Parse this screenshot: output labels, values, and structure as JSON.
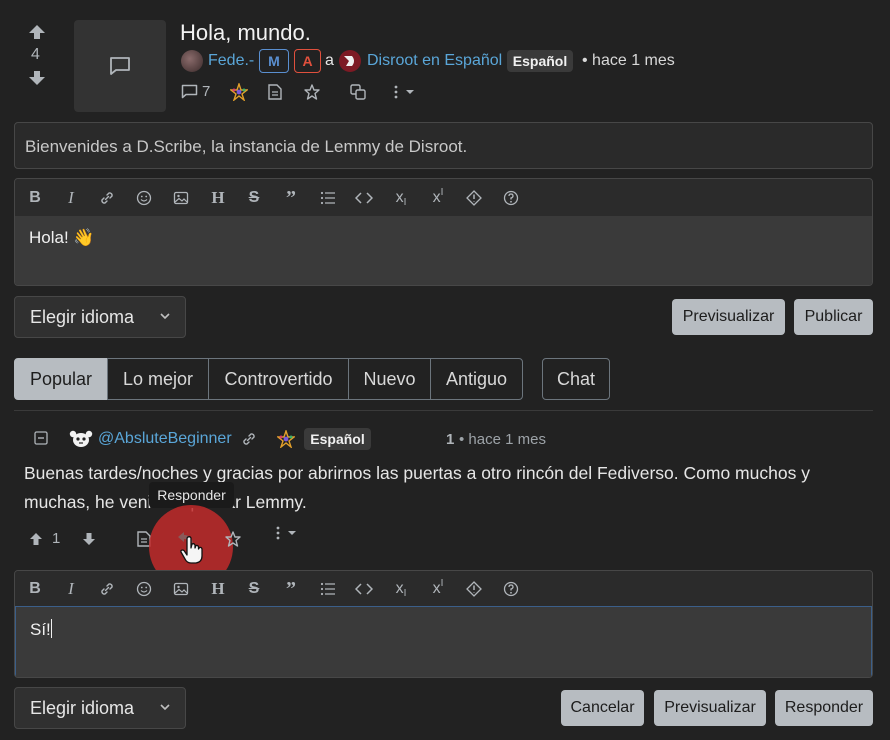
{
  "post": {
    "score": "4",
    "title": "Hola, mundo.",
    "author": "Fede.-",
    "badge_m": "M",
    "badge_a": "A",
    "connector": "a",
    "community": "Disroot en Español",
    "language": "Español",
    "time": "• hace 1 mes",
    "comment_count": "7",
    "body": "Bienvenides a D.Scribe, la instancia de Lemmy de Disroot."
  },
  "editor_top": {
    "text": "Hola! 👋",
    "language_select": "Elegir idioma",
    "preview_label": "Previsualizar",
    "publish_label": "Publicar"
  },
  "sort_tabs": [
    "Popular",
    "Lo mejor",
    "Controvertido",
    "Nuevo",
    "Antiguo"
  ],
  "chat_label": "Chat",
  "comment": {
    "collapse": "⊟",
    "author": "@AbsluteBeginner",
    "language": "Español",
    "score": "1",
    "time": "• hace 1 mes",
    "body": "Buenas tardes/noches y gracias por abrirnos las puertas a otro rincón del Fediverso. Como muchos y muchas, he venido a probar Lemmy.",
    "upvotes": "1",
    "tooltip": "Responder"
  },
  "reply_editor": {
    "text": "Sí!",
    "language_select": "Elegir idioma",
    "cancel_label": "Cancelar",
    "preview_label": "Previsualizar",
    "reply_label": "Responder"
  },
  "toolbar_icons": [
    "bold-icon",
    "italic-icon",
    "link-icon",
    "emoji-icon",
    "image-icon",
    "header-icon",
    "strikethrough-icon",
    "quote-icon",
    "list-icon",
    "code-icon",
    "subscript-icon",
    "superscript-icon",
    "spoiler-icon",
    "help-icon"
  ],
  "colors": {
    "background": "#222222",
    "accent_link": "#5aa6d8",
    "button_light": "#b7bcc1",
    "moderator_badge": "#5a8fd0",
    "admin_badge": "#e0503d",
    "reply_highlight": "#c12a2a"
  }
}
